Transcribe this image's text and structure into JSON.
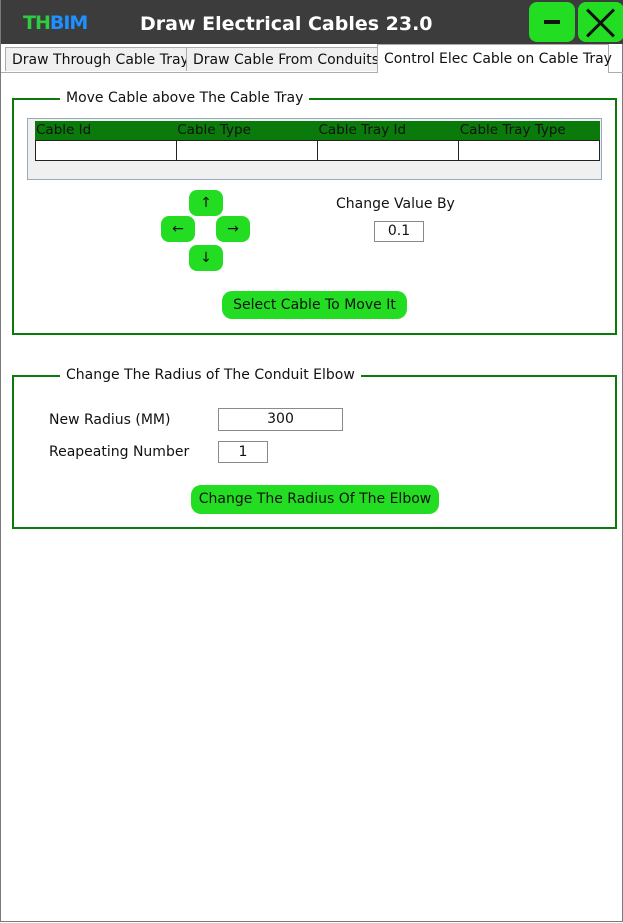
{
  "app": {
    "logo_part1": "TH",
    "logo_part2": "BIM",
    "title": "Draw Electrical Cables 23.0",
    "minimize_label": "minimize",
    "close_label": "close"
  },
  "tabs": [
    {
      "label": "Draw Through Cable Tray",
      "active": false
    },
    {
      "label": "Draw Cable From Conduits",
      "active": false
    },
    {
      "label": "Control Elec Cable on Cable Tray",
      "active": true
    }
  ],
  "move_group": {
    "legend": "Move Cable above The Cable Tray",
    "columns": [
      "Cable Id",
      "Cable Type",
      "Cable Tray Id",
      "Cable Tray Type"
    ],
    "arrows": {
      "up": "↑",
      "left": "←",
      "right": "→",
      "down": "↓"
    },
    "change_value_label": "Change Value By",
    "change_value": "0.1",
    "select_button": "Select Cable To Move It"
  },
  "radius_group": {
    "legend": "Change The Radius of The Conduit Elbow",
    "new_radius_label": "New Radius (MM)",
    "new_radius_value": "300",
    "repeating_label": "Reapeating Number",
    "repeating_value": "1",
    "change_button": "Change The Radius Of The Elbow"
  },
  "colors": {
    "titlebar": "#3c3c3c",
    "accent_green": "#22dd22",
    "border_green": "#0a7a0a",
    "logo_green": "#2ecc40",
    "logo_blue": "#1e90ff"
  }
}
